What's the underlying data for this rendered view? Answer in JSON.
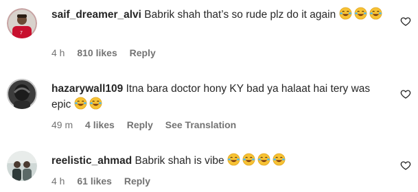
{
  "comments": [
    {
      "username": "saif_dreamer_alvi",
      "text": "Babrik shah that’s so rude plz do it again",
      "time": "4 h",
      "likes": "810 likes",
      "reply": "Reply",
      "avatar_icon": "avatar-red-jersey",
      "emoji_count": 3
    },
    {
      "username": "hazarywall109",
      "text": "Itna bara doctor hony KY bad ya halaat hai tery was epic",
      "time": "49 m",
      "likes": "4 likes",
      "reply": "Reply",
      "see_translation": "See Translation",
      "avatar_icon": "avatar-dark-helmet",
      "emoji_count": 2
    },
    {
      "username": "reelistic_ahmad",
      "text": "Babrik shah is vibe",
      "time": "4 h",
      "likes": "61 likes",
      "reply": "Reply",
      "avatar_icon": "avatar-two-people",
      "emoji_count": 4
    }
  ],
  "icons": {
    "emoji": "face-with-tears-of-joy-icon",
    "like": "heart-outline-icon"
  },
  "colors": {
    "text": "#262626",
    "meta": "#737373",
    "emoji_face": "#f7c234"
  }
}
